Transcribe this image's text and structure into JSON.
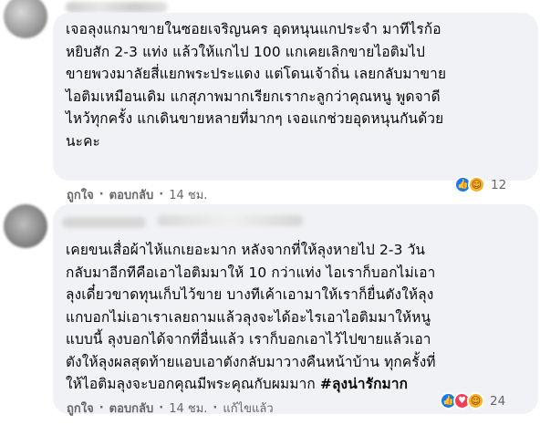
{
  "comments": [
    {
      "lines": [
        "เจอลุงแกมาขายในซอยเจริญนคร อุดหนุนแกประจำ มาทีไรก้อ",
        "หยิบสัก 2-3 แท่ง แล้วให้แกไป 100 แกเคยเลิกขายไอติมไป",
        "ขายพวงมาลัยสี่แยกพระประแดง แต่โดนเจ้าถิ่น เลยกลับมาขาย",
        "ไอติมเหมือนเดิม แกสุภาพมากเรียกเรากะลูกว่าคุณหนู พูดจาดี",
        "ไหว้ทุกครั้ง แกเดินขายหลายที่มากๆ เจอแกช่วยอุดหนุนกันด้วย",
        "นะคะ"
      ],
      "actions": {
        "like": "ถูกใจ",
        "reply": "ตอบกลับ",
        "time": "14 ชม."
      },
      "reactions": {
        "count": "12",
        "icons": [
          "like-icon",
          "care-icon"
        ]
      }
    },
    {
      "lines": [
        "เคยขนเสื่อผ้าไห้แกเยอะมาก หลังจากที่ให้ลุงหายไป 2-3 วัน",
        "กลับมาอีกทีคือเอาไอติมมาให้ 10 กว่าแท่ง ไอเราก็บอกไม่เอา",
        "ลุงเดี๋ยวขาดทุนเก็บไว้ขาย บางทีเค้าเอามาให้เราก็ยื่นตังให้ลุง",
        "แกบอกไม่เอาเราเลยถามแล้วลุงจะได้อะไรเอาไอติมมาให้หนู",
        "แบบนี้ ลุงบอกได้จากที่อื่นแล้ว เราก็บอกเอาไว้ไปขายแล้วเอา",
        "ตังให้ลุงผลสุดท้ายแอบเอาตังกลับมาวางคืนหน้าบ้าน ทุกครั้งที่",
        "ให้ไอติมลุงจะบอกคุณมีพระคุณกับผมมาก "
      ],
      "hashtag": "#ลุงน่ารักมาก",
      "actions": {
        "like": "ถูกใจ",
        "reply": "ตอบกลับ",
        "time": "14 ชม.",
        "edited": "แก้ไขแล้ว"
      },
      "reactions": {
        "count": "24",
        "icons": [
          "like-icon",
          "love-icon",
          "care-icon"
        ]
      }
    }
  ],
  "colors": {
    "bubble": "#f0f2f5",
    "meta": "#65676b",
    "like": "#1877f2",
    "love": "#f33e58",
    "care": "#f7b125"
  }
}
